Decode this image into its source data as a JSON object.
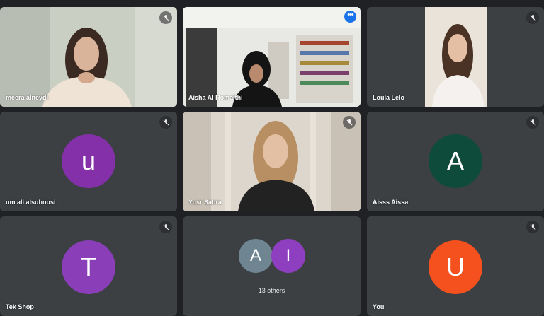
{
  "participants": [
    {
      "name": "meera alneydi",
      "muted": true
    },
    {
      "name": "Aisha Al Romaithi",
      "muted": false
    },
    {
      "name": "Loula Lelo",
      "muted": true
    },
    {
      "name": "um ali alsubousi",
      "initial": "u",
      "avatar_color": "#8430a8",
      "muted": true
    },
    {
      "name": "Yusr Sabra",
      "muted": true
    },
    {
      "name": "Aisss Aissa",
      "initial": "A",
      "avatar_color": "#0e4b3b",
      "muted": true
    },
    {
      "name": "Tek Shop",
      "initial": "T",
      "avatar_color": "#8a3fb8",
      "muted": true
    },
    {
      "name": "You",
      "initial": "U",
      "avatar_color": "#f4511e",
      "muted": true
    }
  ],
  "others": {
    "label": "13 others",
    "avatars": [
      {
        "initial": "A",
        "color": "#6f8591"
      },
      {
        "initial": "I",
        "color": "#8e3fc0"
      }
    ]
  },
  "colors": {
    "background": "#202124",
    "tile": "#3c4043",
    "active_speaker_border": "#8ab4f8",
    "more_button": "#1a73e8"
  },
  "icons": {
    "mic_off": "mic-off-icon",
    "more": "more-options-icon"
  }
}
